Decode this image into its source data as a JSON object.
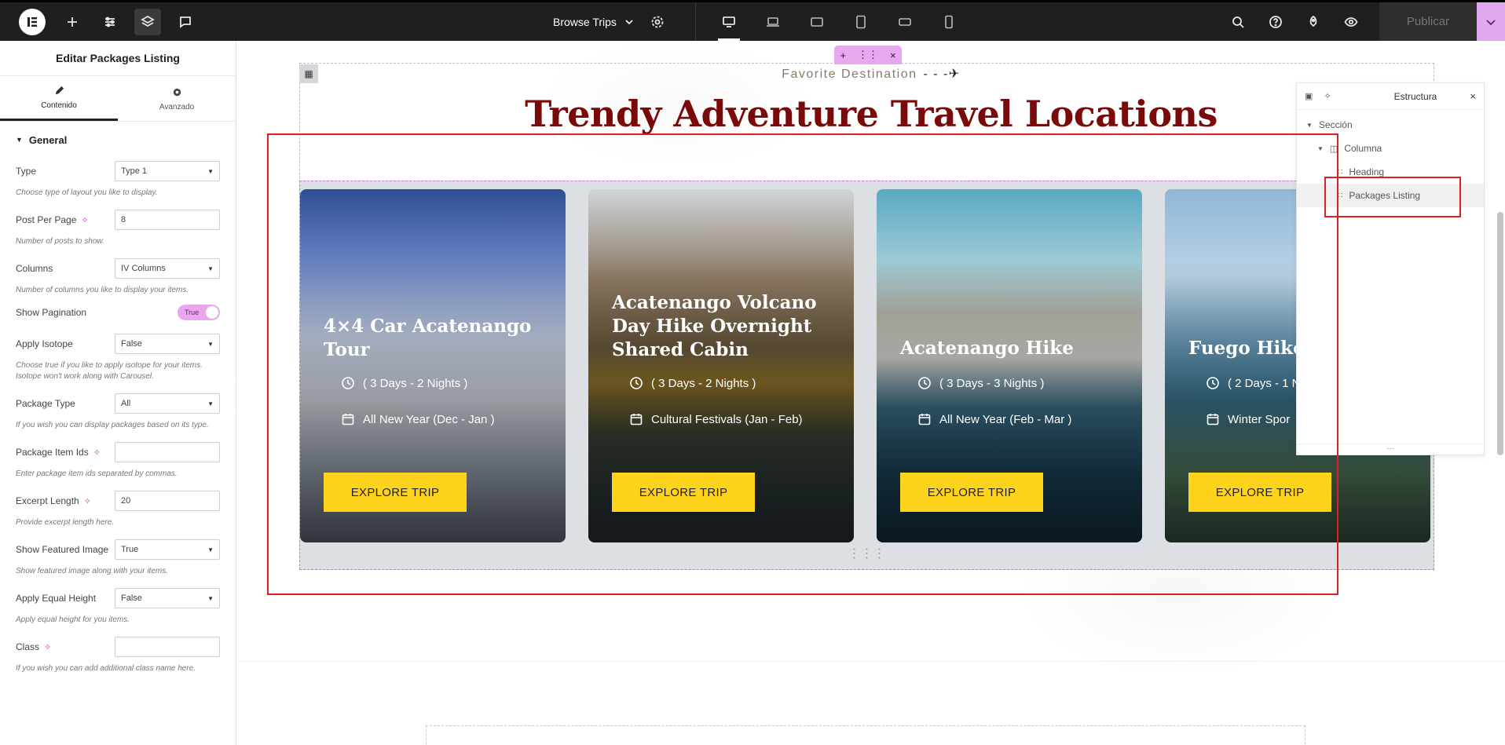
{
  "topbar": {
    "page_selector": "Browse Trips",
    "publish_label": "Publicar"
  },
  "panel": {
    "title": "Editar Packages Listing",
    "tabs": [
      {
        "label": "Contenido",
        "icon": "pencil-icon"
      },
      {
        "label": "Avanzado",
        "icon": "gear-icon"
      }
    ],
    "section": "General",
    "controls": {
      "type": {
        "label": "Type",
        "value": "Type 1",
        "help": "Choose type of layout you like to display."
      },
      "post_per_page": {
        "label": "Post Per Page",
        "value": "8",
        "help": "Number of posts to show."
      },
      "columns": {
        "label": "Columns",
        "value": "IV Columns",
        "help": "Number of columns you like to display your items."
      },
      "show_pagination": {
        "label": "Show Pagination",
        "value": "True"
      },
      "apply_isotope": {
        "label": "Apply Isotope",
        "value": "False",
        "help": "Choose true if you like to apply isotope for your items. Isotope won't work along with Carousel."
      },
      "package_type": {
        "label": "Package Type",
        "value": "All",
        "help": "If you wish you can display packages based on its type."
      },
      "package_item_ids": {
        "label": "Package Item Ids",
        "value": "",
        "help": "Enter package item ids separated by commas."
      },
      "excerpt_length": {
        "label": "Excerpt Length",
        "value": "20",
        "help": "Provide excerpt length here."
      },
      "show_featured_image": {
        "label": "Show Featured Image",
        "value": "True",
        "help": "Show featured image along with your items."
      },
      "apply_equal_height": {
        "label": "Apply Equal Height",
        "value": "False",
        "help": "Apply equal height for you items."
      },
      "class": {
        "label": "Class",
        "value": "",
        "help": "If you wish you can add additional class name here."
      }
    }
  },
  "canvas": {
    "subtitle": "Favorite  Destination",
    "heading": "Trendy Adventure Travel Locations",
    "cards": [
      {
        "title": "4×4 Car Acatenango Tour",
        "duration": "( 3 Days - 2 Nights )",
        "season": "All New Year (Dec - Jan )",
        "button": "EXPLORE TRIP"
      },
      {
        "title": "Acatenango Volcano Day Hike Overnight Shared Cabin",
        "duration": "( 3 Days - 2 Nights )",
        "season": "Cultural Festivals (Jan - Feb)",
        "button": "EXPLORE TRIP"
      },
      {
        "title": "Acatenango Hike",
        "duration": "( 3 Days - 3 Nights )",
        "season": "All New Year (Feb - Mar )",
        "button": "EXPLORE TRIP"
      },
      {
        "title": "Fuego Hike",
        "duration": "( 2 Days - 1 N",
        "season": "Winter Spor",
        "button": "EXPLORE TRIP"
      }
    ]
  },
  "structure": {
    "title": "Estructura",
    "tree": [
      {
        "label": "Sección",
        "level": 0
      },
      {
        "label": "Columna",
        "level": 1
      },
      {
        "label": "Heading",
        "level": 2
      },
      {
        "label": "Packages Listing",
        "level": 2
      }
    ]
  },
  "colors": {
    "accent_pink": "#e7a8ef",
    "heading_red": "#7a0a0a",
    "button_yellow": "#fdd31b",
    "highlight_red": "#e02020"
  }
}
